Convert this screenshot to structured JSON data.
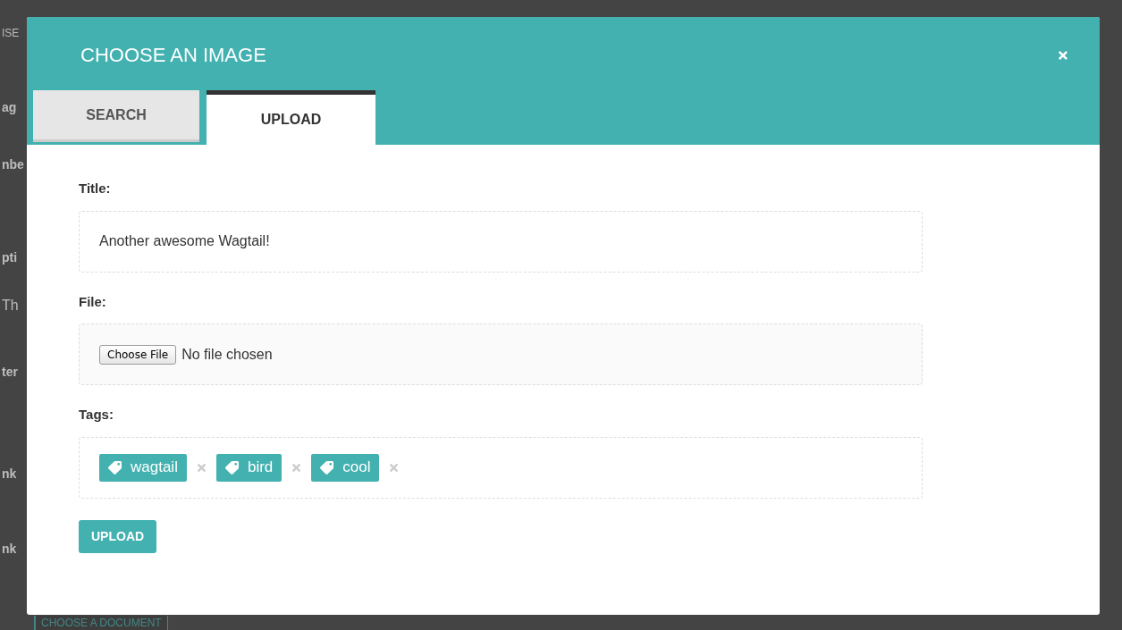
{
  "background": {
    "fragments": [
      {
        "text": "ISE",
        "kind": "link"
      },
      {
        "text": "ag",
        "kind": "label"
      },
      {
        "text": "nbe",
        "kind": "label"
      },
      {
        "text": "pti",
        "kind": "label"
      },
      {
        "text": "Th",
        "kind": "value"
      },
      {
        "text": "ter",
        "kind": "label"
      },
      {
        "text": "nk",
        "kind": "label"
      },
      {
        "text": "nk",
        "kind": "label"
      }
    ],
    "button": "CHOOSE A DOCUMENT"
  },
  "modal": {
    "title": "CHOOSE AN IMAGE",
    "tabs": [
      {
        "label": "SEARCH",
        "selected": false
      },
      {
        "label": "UPLOAD",
        "selected": true
      }
    ],
    "fields": [
      {
        "kind": "text",
        "label": "Title:",
        "value": "Another awesome Wagtail!"
      },
      {
        "kind": "file",
        "label": "File:",
        "button": "Choose File",
        "status": "No file chosen"
      },
      {
        "kind": "tags",
        "label": "Tags:",
        "tags": [
          "wagtail",
          "bird",
          "cool"
        ]
      }
    ],
    "submit": "UPLOAD"
  }
}
